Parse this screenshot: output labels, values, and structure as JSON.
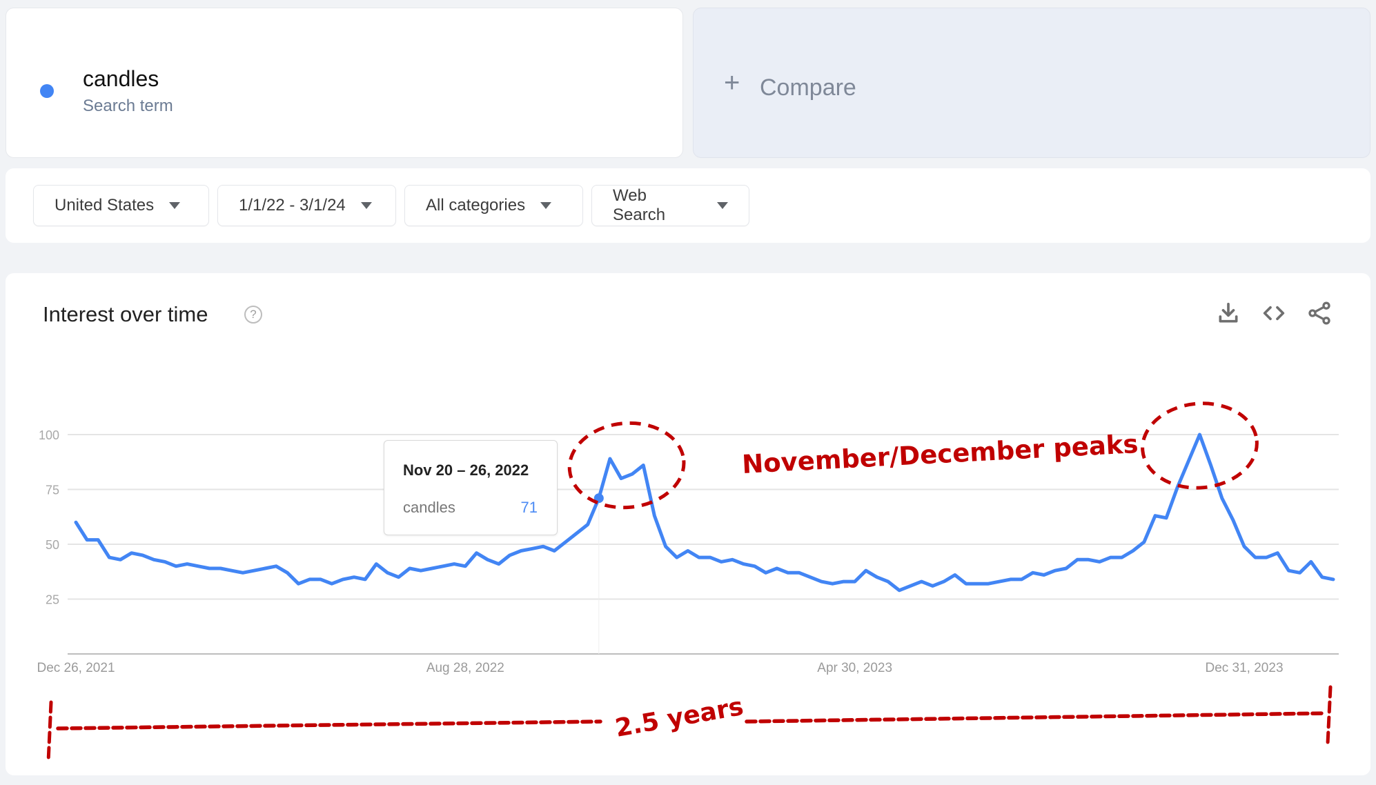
{
  "search_term": {
    "name": "candles",
    "type_label": "Search term",
    "color": "#4285f4"
  },
  "compare": {
    "plus_glyph": "+",
    "label": "Compare"
  },
  "filters": {
    "region": "United States",
    "date_range": "1/1/22 - 3/1/24",
    "category": "All categories",
    "property": "Web Search"
  },
  "chart_card": {
    "title": "Interest over time",
    "help_glyph": "?",
    "icons": [
      "download-icon",
      "embed-code-icon",
      "share-icon"
    ]
  },
  "tooltip": {
    "date": "Nov 20 – 26, 2022",
    "series": "candles",
    "value": "71",
    "point_index": 47
  },
  "annotations": {
    "peaks_label": "November/December peaks",
    "span_label": "2.5 years",
    "color": "#c00000"
  },
  "chart_data": {
    "type": "line",
    "title": "Interest over time",
    "xlabel": "",
    "ylabel": "",
    "ylim": [
      0,
      100
    ],
    "yticks": [
      25,
      50,
      75,
      100
    ],
    "ytick_labels": [
      "25",
      "50",
      "75",
      "100"
    ],
    "x_start": "Dec 26, 2021",
    "x_interval": "weekly",
    "xtick_labels": [
      {
        "label": "Dec 26, 2021",
        "index": 0
      },
      {
        "label": "Aug 28, 2022",
        "index": 35
      },
      {
        "label": "Apr 30, 2023",
        "index": 70
      },
      {
        "label": "Dec 31, 2023",
        "index": 105
      }
    ],
    "grid": true,
    "legend": "none",
    "series": [
      {
        "name": "candles",
        "color": "#4285f4",
        "values": [
          60,
          52,
          52,
          44,
          43,
          46,
          45,
          43,
          42,
          40,
          41,
          40,
          39,
          39,
          38,
          37,
          38,
          39,
          40,
          37,
          32,
          34,
          34,
          32,
          34,
          35,
          34,
          41,
          37,
          35,
          39,
          38,
          39,
          40,
          41,
          40,
          46,
          43,
          41,
          45,
          47,
          48,
          49,
          47,
          51,
          55,
          59,
          71,
          89,
          80,
          82,
          86,
          63,
          49,
          44,
          47,
          44,
          44,
          42,
          43,
          41,
          40,
          37,
          39,
          37,
          37,
          35,
          33,
          32,
          33,
          33,
          38,
          35,
          33,
          29,
          31,
          33,
          31,
          33,
          36,
          32,
          32,
          32,
          33,
          34,
          34,
          37,
          36,
          38,
          39,
          43,
          43,
          42,
          44,
          44,
          47,
          51,
          63,
          62,
          76,
          88,
          100,
          86,
          71,
          61,
          49,
          44,
          44,
          46,
          38,
          37,
          42,
          35,
          34
        ]
      }
    ]
  }
}
